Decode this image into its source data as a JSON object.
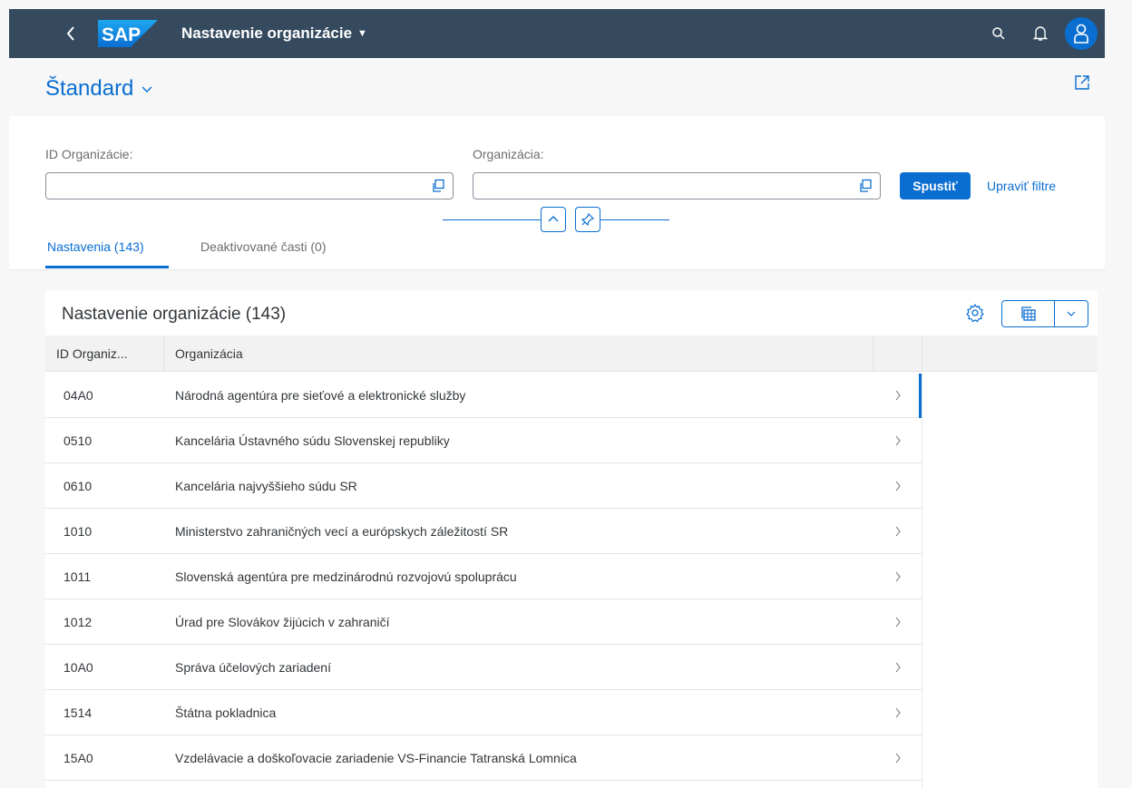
{
  "shell": {
    "logo_text": "SAP",
    "app_title": "Nastavenie organizácie",
    "icons": {
      "back": "back-icon",
      "search": "search-icon",
      "notifications": "bell-icon",
      "user": "user-icon"
    }
  },
  "header": {
    "variant_label": "Štandard"
  },
  "filters": {
    "fields": [
      {
        "label": "ID Organizácie:",
        "value": ""
      },
      {
        "label": "Organizácia:",
        "value": ""
      }
    ],
    "go_label": "Spustiť",
    "adapt_label": "Upraviť filtre"
  },
  "tabs": [
    {
      "label": "Nastavenia (143)",
      "active": true
    },
    {
      "label": "Deaktivované časti (0)",
      "active": false
    }
  ],
  "table": {
    "title": "Nastavenie organizácie (143)",
    "columns": [
      "ID Organiz...",
      "Organizácia"
    ],
    "rows": [
      {
        "id": "04A0",
        "org": "Národná agentúra pre sieťové a elektronické služby"
      },
      {
        "id": "0510",
        "org": "Kancelária Ústavného súdu Slovenskej republiky"
      },
      {
        "id": "0610",
        "org": "Kancelária najvyššieho súdu SR"
      },
      {
        "id": "1010",
        "org": "Ministerstvo zahraničných vecí a európskych záležitostí SR"
      },
      {
        "id": "1011",
        "org": "Slovenská agentúra pre medzinárodnú rozvojovú spoluprácu"
      },
      {
        "id": "1012",
        "org": "Úrad pre Slovákov žijúcich v zahraničí"
      },
      {
        "id": "10A0",
        "org": "Správa účelových zariadení"
      },
      {
        "id": "1514",
        "org": "Štátna pokladnica"
      },
      {
        "id": "15A0",
        "org": "Vzdelávacie a doškoľovacie zariadenie VS-Financie Tatranská Lomnica"
      }
    ]
  },
  "colors": {
    "shell": "#354a5f",
    "accent": "#0a6ed1",
    "text": "#32363a"
  }
}
